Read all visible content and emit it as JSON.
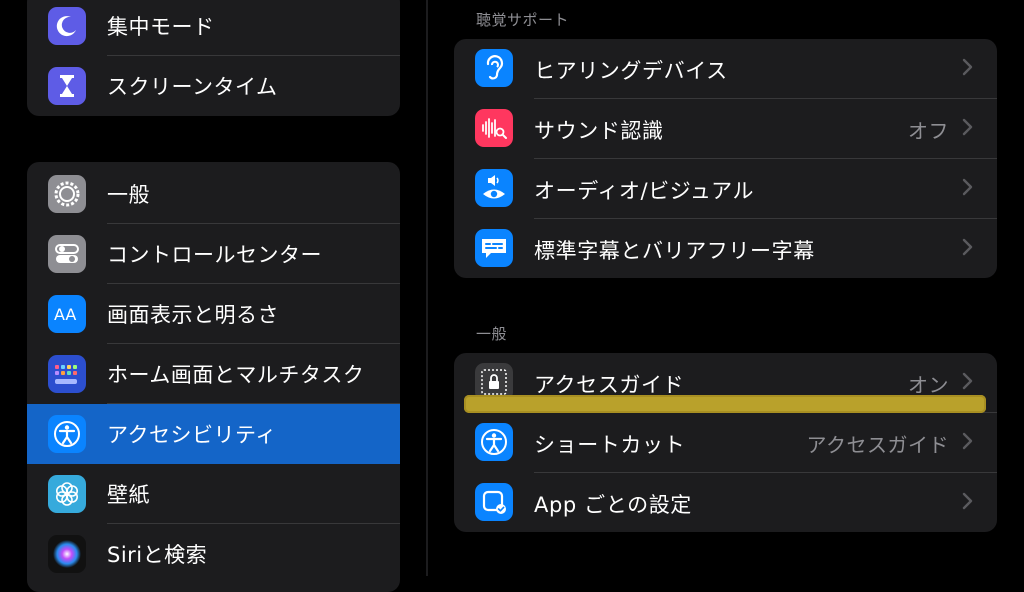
{
  "sidebar": {
    "group1": [
      {
        "label": "集中モード",
        "icon": "moon-icon",
        "color": "#5e5ce6"
      },
      {
        "label": "スクリーンタイム",
        "icon": "hourglass-icon",
        "color": "#5e5ce6"
      }
    ],
    "group2": [
      {
        "label": "一般",
        "icon": "gear-icon",
        "color": "#8e8e93"
      },
      {
        "label": "コントロールセンター",
        "icon": "toggles-icon",
        "color": "#8e8e93"
      },
      {
        "label": "画面表示と明るさ",
        "icon": "text-size-icon",
        "color": "#0a84ff"
      },
      {
        "label": "ホーム画面とマルチタスク",
        "icon": "home-grid-icon",
        "color": "#2c4fcf"
      },
      {
        "label": "アクセシビリティ",
        "icon": "accessibility-icon",
        "color": "#0a84ff",
        "selected": true
      },
      {
        "label": "壁紙",
        "icon": "flower-icon",
        "color": "#36aadc"
      },
      {
        "label": "Siriと検索",
        "icon": "siri-icon",
        "color": "#222"
      }
    ]
  },
  "main": {
    "hearing": {
      "title": "聴覚サポート",
      "rows": [
        {
          "label": "ヒアリングデバイス",
          "value": "",
          "icon": "ear-icon",
          "color": "#0a84ff"
        },
        {
          "label": "サウンド認識",
          "value": "オフ",
          "icon": "sound-wave-icon",
          "color": "#ff375f"
        },
        {
          "label": "オーディオ/ビジュアル",
          "value": "",
          "icon": "speaker-eye-icon",
          "color": "#0a84ff"
        },
        {
          "label": "標準字幕とバリアフリー字幕",
          "value": "",
          "icon": "caption-icon",
          "color": "#0a84ff"
        }
      ]
    },
    "general": {
      "title": "一般",
      "rows": [
        {
          "label": "アクセスガイド",
          "value": "オン",
          "icon": "lock-icon",
          "color": "#3a3a3c"
        },
        {
          "label": "ショートカット",
          "value": "アクセスガイド",
          "icon": "accessibility-icon",
          "color": "#0a84ff"
        },
        {
          "label": "App ごとの設定",
          "value": "",
          "icon": "app-settings-icon",
          "color": "#0a84ff"
        }
      ]
    }
  },
  "highlight_color": "#b9a12b"
}
